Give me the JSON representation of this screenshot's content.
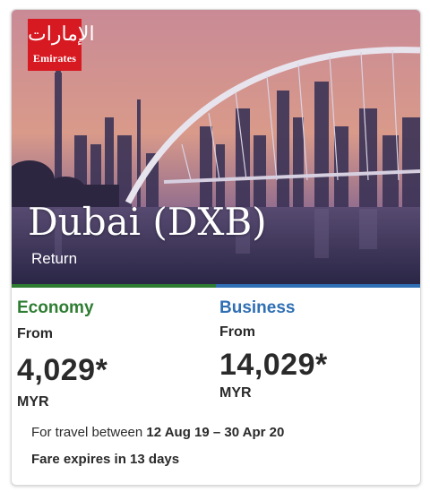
{
  "card": {
    "brand": {
      "name": "Emirates",
      "mark": "الإمارات",
      "icon": "emirates-logo"
    },
    "destination": "Dubai (DXB)",
    "trip_type": "Return",
    "colors": {
      "economy": "#2e7d32",
      "business": "#2f6fb3",
      "brand_red": "#d71921"
    },
    "economy": {
      "cabin": "Economy",
      "from_label": "From",
      "price": "4,029*",
      "currency": "MYR"
    },
    "business": {
      "cabin": "Business",
      "from_label": "From",
      "price": "14,029*",
      "currency": "MYR"
    },
    "travel": {
      "prefix": "For travel between",
      "dates": "12 Aug 19 – 30 Apr 20"
    },
    "expiry": "Fare expires in 13 days"
  }
}
